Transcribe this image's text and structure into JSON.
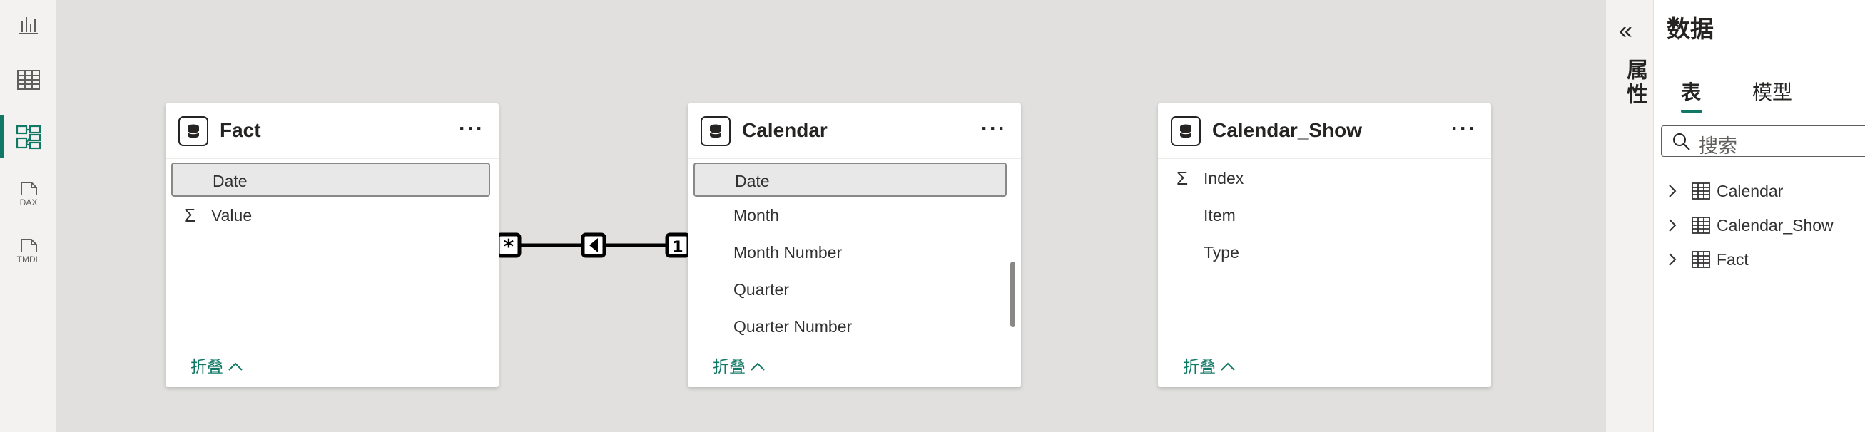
{
  "rail": {
    "items": [
      {
        "name": "report-view",
        "icon": "bar-chart-icon"
      },
      {
        "name": "table-view",
        "icon": "table-grid-icon"
      },
      {
        "name": "model-view",
        "icon": "model-icon",
        "active": true
      },
      {
        "name": "dax-query-view",
        "icon": "dax-icon",
        "label": "DAX"
      },
      {
        "name": "tmdl-view",
        "icon": "tmdl-icon",
        "label": "TMDL"
      }
    ]
  },
  "tables": [
    {
      "title": "Fact",
      "fields": [
        {
          "label": "Date",
          "selected": true,
          "measure": false
        },
        {
          "label": "Value",
          "selected": false,
          "measure": true
        }
      ],
      "collapse_label": "折叠"
    },
    {
      "title": "Calendar",
      "fields": [
        {
          "label": "Date",
          "selected": true,
          "measure": false
        },
        {
          "label": "Month",
          "selected": false,
          "measure": false
        },
        {
          "label": "Month Number",
          "selected": false,
          "measure": false
        },
        {
          "label": "Quarter",
          "selected": false,
          "measure": false
        },
        {
          "label": "Quarter Number",
          "selected": false,
          "measure": false
        }
      ],
      "collapse_label": "折叠"
    },
    {
      "title": "Calendar_Show",
      "fields": [
        {
          "label": "Index",
          "selected": false,
          "measure": true
        },
        {
          "label": "Item",
          "selected": false,
          "measure": false
        },
        {
          "label": "Type",
          "selected": false,
          "measure": false
        }
      ],
      "collapse_label": "折叠"
    }
  ],
  "relationship": {
    "from_cardinality": "*",
    "to_cardinality": "1"
  },
  "properties_pane": {
    "collapse_glyph": "«",
    "label": "属性"
  },
  "data_pane": {
    "title": "数据",
    "tabs": [
      {
        "label": "表",
        "active": true
      },
      {
        "label": "模型",
        "active": false
      }
    ],
    "search_placeholder": "搜索",
    "tree": [
      "Calendar",
      "Calendar_Show",
      "Fact"
    ]
  },
  "colors": {
    "accent": "#117865",
    "canvas": "#e1e0df"
  }
}
